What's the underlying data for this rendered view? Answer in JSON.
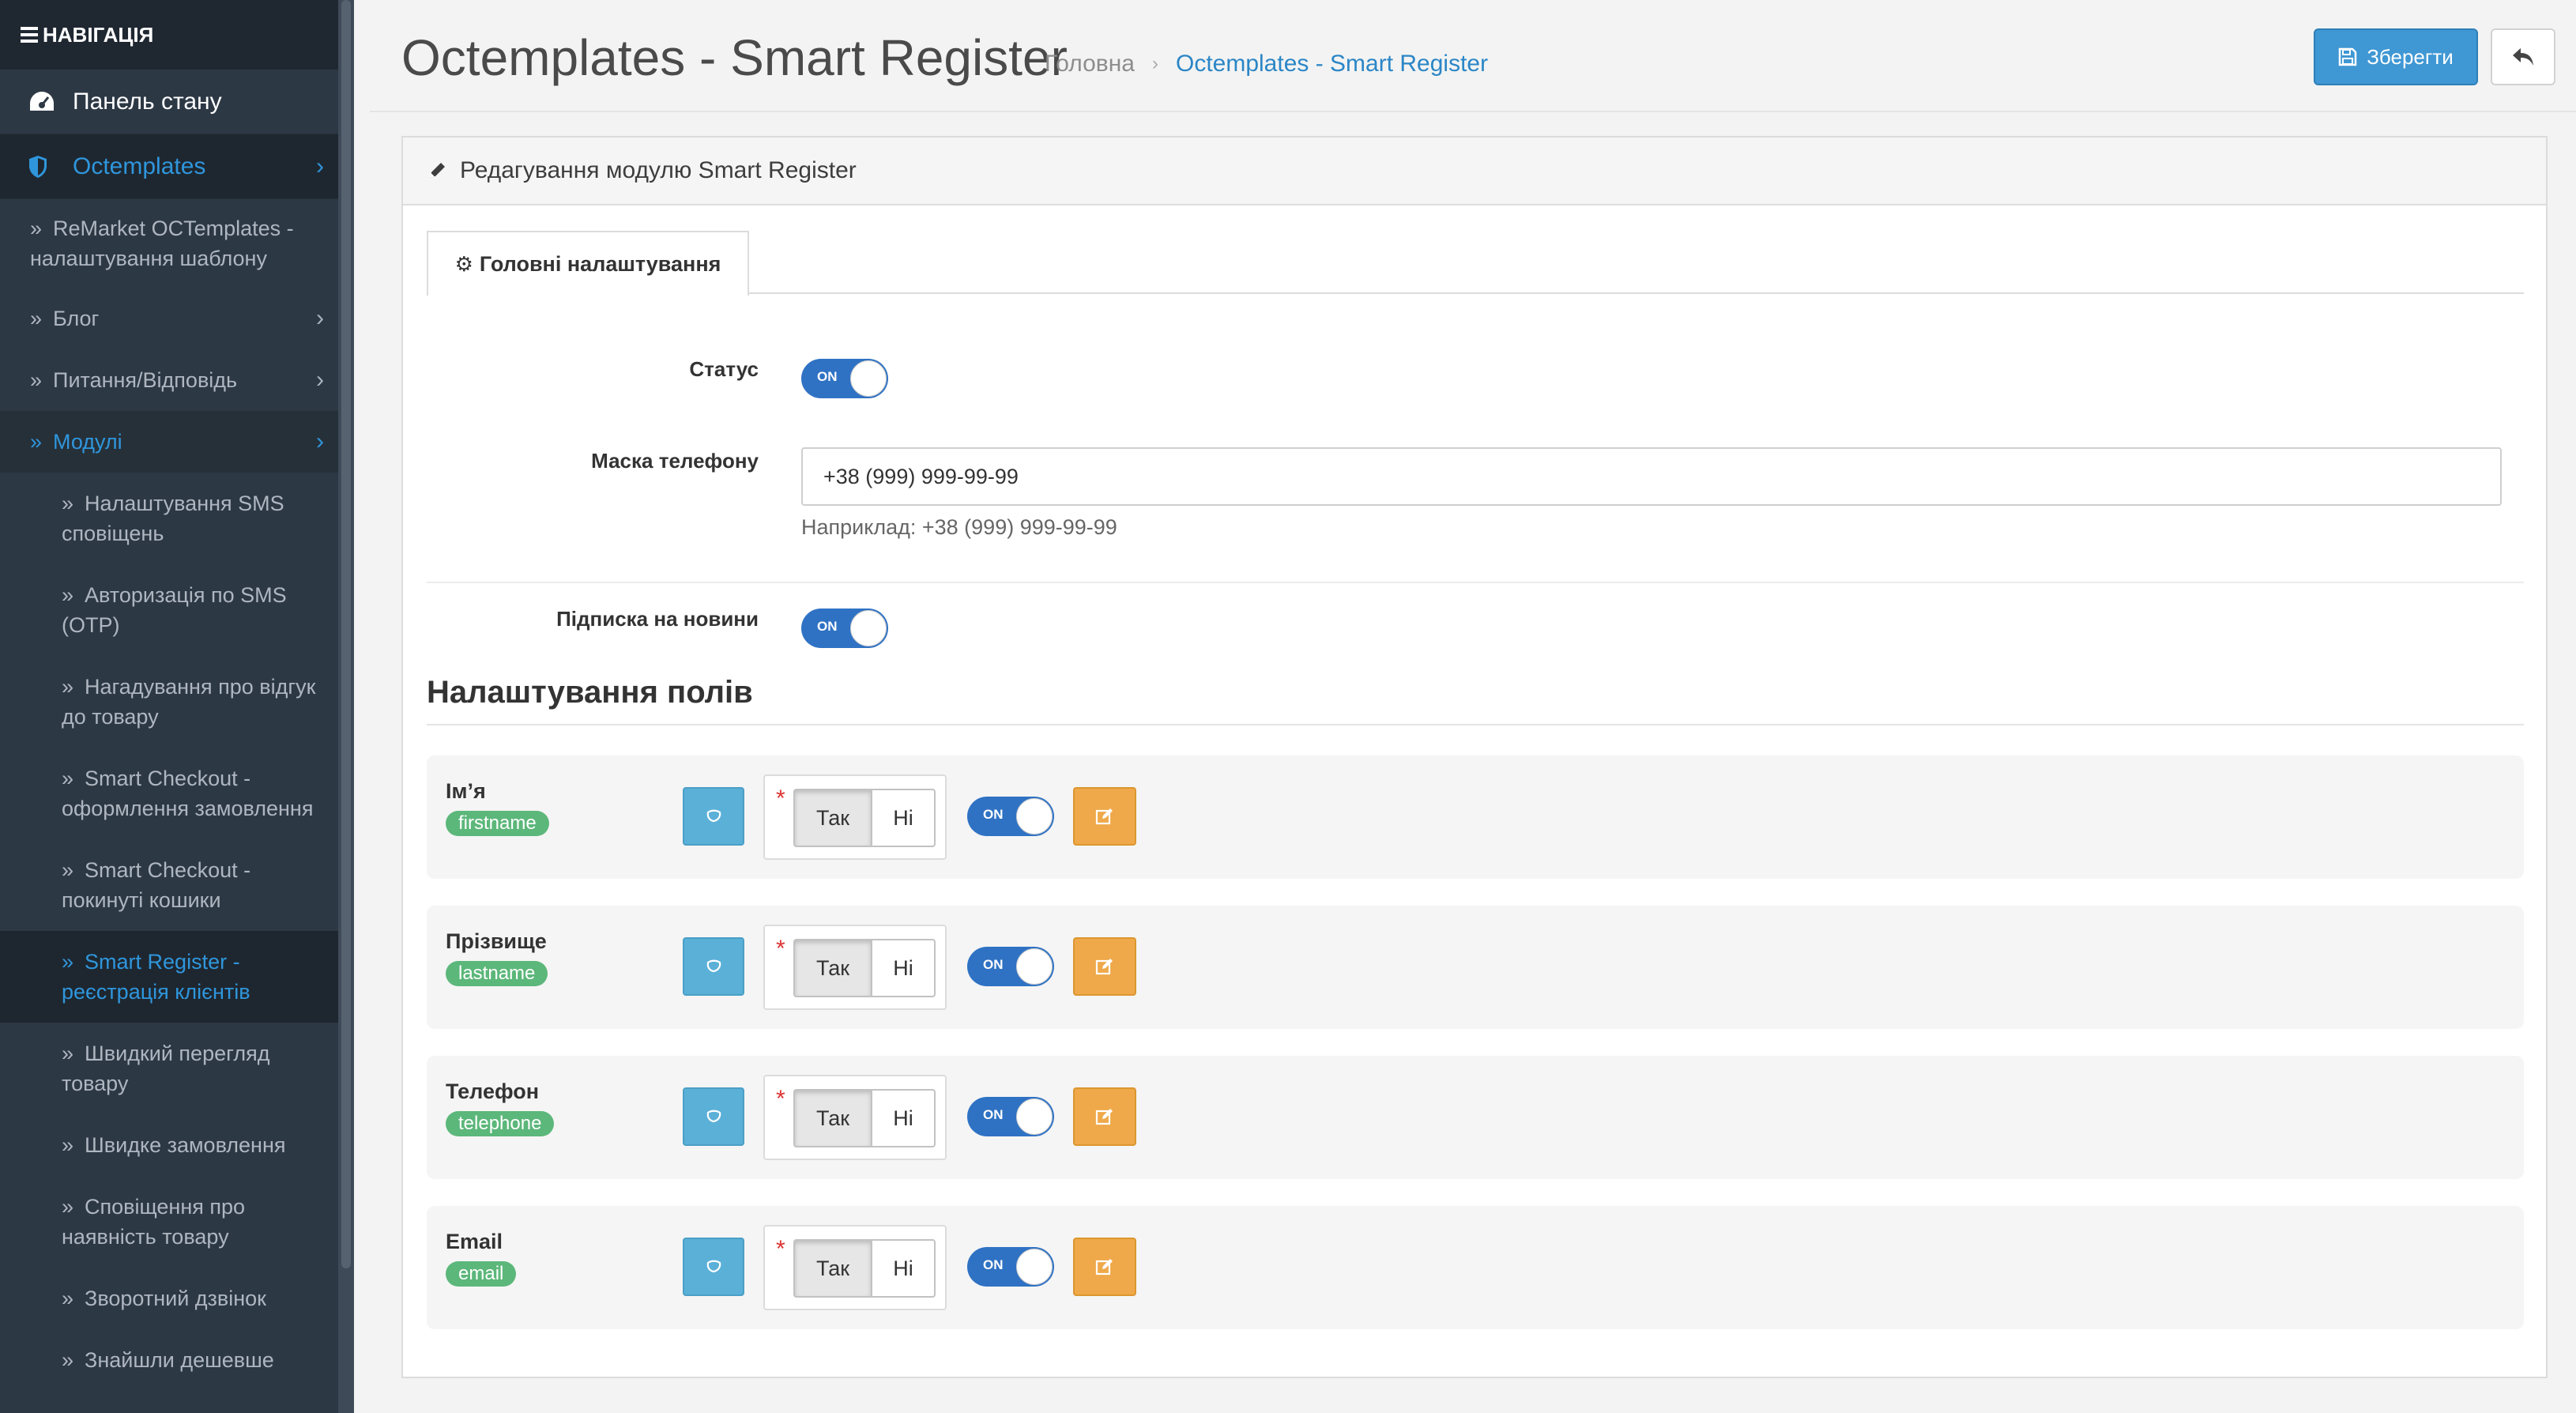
{
  "nav": {
    "heading": "НАВІГАЦІЯ",
    "items": [
      {
        "label": "Панель стану",
        "icon": "dashboard-icon"
      },
      {
        "label": "Octemplates",
        "icon": "shield-icon"
      }
    ],
    "sub": [
      {
        "label": "ReMarket OCTemplates - налаштування шаблону"
      },
      {
        "label": "Блог"
      },
      {
        "label": "Питання/Відповідь"
      },
      {
        "label": "Модулі"
      }
    ],
    "modules": [
      "Налаштування SMS сповіщень",
      "Авторизація по SMS (OTP)",
      "Нагадування про відгук до товару",
      "Smart Checkout - оформлення замовлення",
      "Smart Checkout - покинуті кошики",
      "Smart Register - реєстрація клієнтів",
      "Швидкий перегляд товару",
      "Швидке замовлення",
      "Сповіщення про наявність товару",
      "Зворотний дзвінок",
      "Знайшли дешевше"
    ]
  },
  "header": {
    "title": "Octemplates - Smart Register",
    "breadcrumb": [
      "Головна",
      "Octemplates - Smart Register"
    ],
    "save_label": "Зберегти"
  },
  "panel": {
    "title": "Редагування модулю Smart Register",
    "tab_label": "Головні налаштування",
    "status_label": "Статус",
    "phone_mask_label": "Маска телефону",
    "phone_mask_value": "+38 (999) 999-99-99",
    "phone_mask_help": "Наприклад: +38 (999) 999-99-99",
    "newsletter_label": "Підписка на новини",
    "toggle_on": "ON",
    "fields_heading": "Налаштування полів",
    "yes_label": "Так",
    "no_label": "Ні",
    "required_mark": "*",
    "fields": [
      {
        "label": "Ім’я",
        "key": "firstname"
      },
      {
        "label": "Прізвище",
        "key": "lastname"
      },
      {
        "label": "Телефон",
        "key": "telephone"
      },
      {
        "label": "Email",
        "key": "email"
      }
    ]
  },
  "colors": {
    "sidebar_bg": "#2d3845",
    "accent_blue": "#2f96dc",
    "toggle_blue": "#2f72c4",
    "save_btn": "#3f97d3",
    "badge_green": "#5cb77a",
    "edit_orange": "#efa94a",
    "drag_blue": "#5bb0d8"
  }
}
